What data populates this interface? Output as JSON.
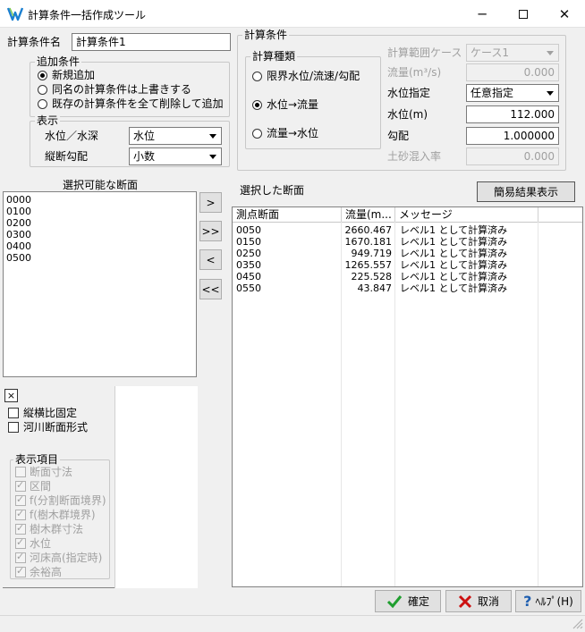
{
  "window": {
    "title": "計算条件一括作成ツール"
  },
  "name_field": {
    "label": "計算条件名",
    "value": "計算条件1"
  },
  "add_conditions": {
    "title": "追加条件",
    "options": [
      {
        "label": "新規追加",
        "selected": true
      },
      {
        "label": "同名の計算条件は上書きする",
        "selected": false
      },
      {
        "label": "既存の計算条件を全て削除して追加",
        "selected": false
      }
    ]
  },
  "display": {
    "title": "表示",
    "level_label": "水位／水深",
    "level_value": "水位",
    "slope_label": "縦断勾配",
    "slope_value": "小数"
  },
  "calc_conditions": {
    "title": "計算条件",
    "type_title": "計算種類",
    "types": [
      {
        "label": "限界水位/流速/勾配",
        "selected": false
      },
      {
        "label": "水位→流量",
        "selected": true
      },
      {
        "label": "流量→水位",
        "selected": false
      }
    ],
    "range_case_label": "計算範囲ケース",
    "range_case_value": "ケース1",
    "flow_label": "流量(m³/s)",
    "flow_value": "0.000",
    "level_spec_label": "水位指定",
    "level_spec_value": "任意指定",
    "water_level_label": "水位(m)",
    "water_level_value": "112.000",
    "slope_label": "勾配",
    "slope_value": "1.000000",
    "sediment_label": "土砂混入率",
    "sediment_value": "0.000"
  },
  "available": {
    "title": "選択可能な断面",
    "items": [
      "0000",
      "0100",
      "0200",
      "0300",
      "0400",
      "0500"
    ]
  },
  "move_buttons": {
    "add": ">",
    "add_all": ">>",
    "remove": "<",
    "remove_all": "<<"
  },
  "selected": {
    "title": "選択した断面",
    "summary_button": "簡易結果表示",
    "columns": [
      "測点断面",
      "流量(m...",
      "メッセージ"
    ],
    "rows": [
      {
        "section": "0050",
        "flow": "2660.467",
        "message": "レベル1 として計算済み"
      },
      {
        "section": "0150",
        "flow": "1670.181",
        "message": "レベル1 として計算済み"
      },
      {
        "section": "0250",
        "flow": "949.719",
        "message": "レベル1 として計算済み"
      },
      {
        "section": "0350",
        "flow": "1265.557",
        "message": "レベル1 として計算済み"
      },
      {
        "section": "0450",
        "flow": "225.528",
        "message": "レベル1 として計算済み"
      },
      {
        "section": "0550",
        "flow": "43.847",
        "message": "レベル1 として計算済み"
      }
    ]
  },
  "preview": {
    "close": "×",
    "aspect_lock": "縦横比固定",
    "river_shape": "河川断面形式",
    "items_title": "表示項目",
    "items": [
      {
        "label": "断面寸法",
        "checked": false
      },
      {
        "label": "区間",
        "checked": true
      },
      {
        "label": "f(分割断面境界)",
        "checked": true
      },
      {
        "label": "f(樹木群境界)",
        "checked": true
      },
      {
        "label": "樹木群寸法",
        "checked": true
      },
      {
        "label": "水位",
        "checked": true
      },
      {
        "label": "河床高(指定時)",
        "checked": true
      },
      {
        "label": "余裕高",
        "checked": true
      }
    ]
  },
  "footer": {
    "ok": "確定",
    "cancel": "取消",
    "help": "ﾍﾙﾌﾟ(H)"
  },
  "colors": {
    "accent": "#0078d7",
    "ok_check": "#1f9e2f",
    "cancel_x": "#cc1010",
    "help": "#1f5fb0"
  }
}
